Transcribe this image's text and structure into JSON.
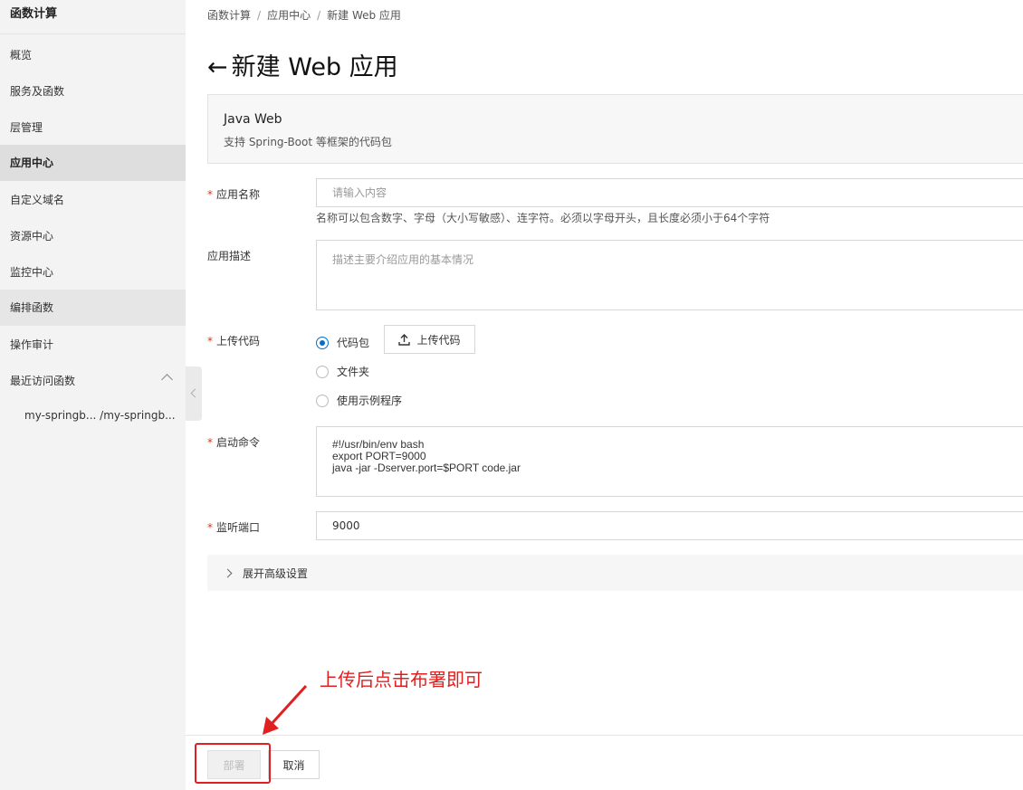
{
  "sidebar": {
    "title": "函数计算",
    "items": [
      {
        "label": "概览"
      },
      {
        "label": "服务及函数"
      },
      {
        "label": "层管理"
      },
      {
        "label": "应用中心"
      },
      {
        "label": "自定义域名"
      },
      {
        "label": "资源中心"
      },
      {
        "label": "监控中心"
      },
      {
        "label": "编排函数"
      },
      {
        "label": "操作审计"
      },
      {
        "label": "最近访问函数"
      }
    ],
    "recent": "my-springb... /my-springb...",
    "active_item": "应用中心"
  },
  "breadcrumb": [
    "函数计算",
    "应用中心",
    "新建 Web 应用"
  ],
  "page": {
    "back_glyph": "←",
    "title": "新建 Web 应用"
  },
  "card": {
    "title": "Java Web",
    "desc": "支持 Spring-Boot 等框架的代码包"
  },
  "form": {
    "app_name": {
      "label": "应用名称",
      "placeholder": "请输入内容",
      "hint": "名称可以包含数字、字母（大小写敏感）、连字符。必须以字母开头，且长度必须小于64个字符"
    },
    "app_desc": {
      "label": "应用描述",
      "placeholder": "描述主要介绍应用的基本情况"
    },
    "upload": {
      "label": "上传代码",
      "options": [
        "代码包",
        "文件夹",
        "使用示例程序"
      ],
      "selected": "代码包",
      "button": "上传代码"
    },
    "start_cmd": {
      "label": "启动命令",
      "lines": [
        "#!/usr/bin/env bash",
        "export PORT=9000",
        "java -jar -Dserver.port=$PORT code.jar"
      ]
    },
    "port": {
      "label": "监听端口",
      "value": "9000"
    },
    "advanced": "展开高级设置"
  },
  "annotation": "上传后点击布署即可",
  "footer": {
    "deploy": "部署",
    "cancel": "取消"
  },
  "colors": {
    "accent": "#0070cc",
    "required": "#e0321a",
    "annotation": "#e02020"
  }
}
